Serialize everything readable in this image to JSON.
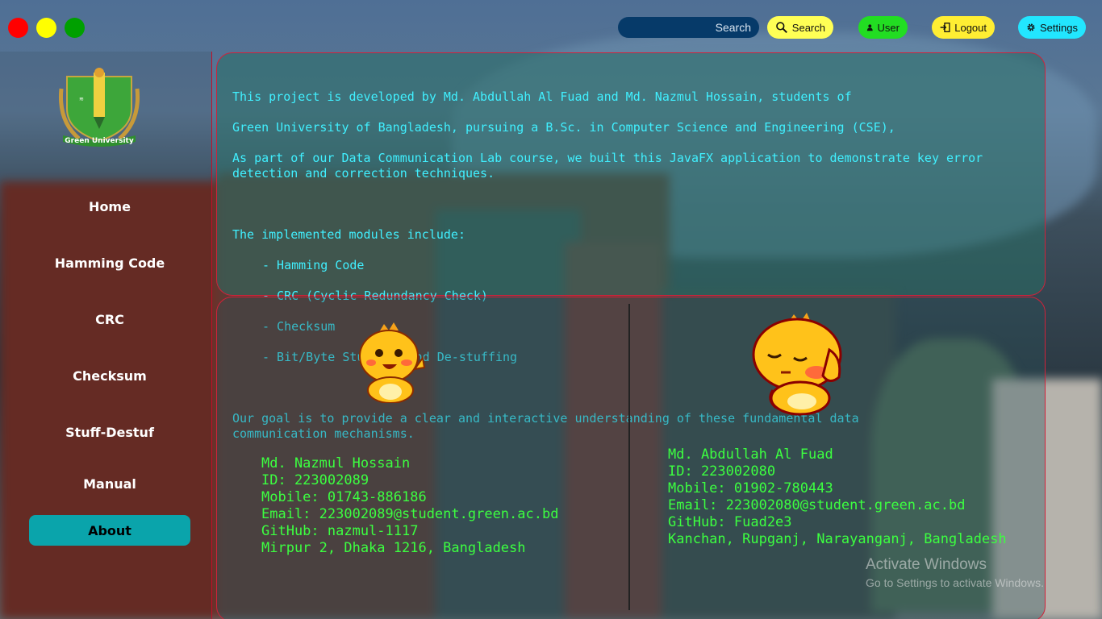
{
  "window": {
    "controls": [
      "close",
      "minimize",
      "maximize"
    ],
    "colors": {
      "close": "#ff0000",
      "minimize": "#ffff00",
      "maximize": "#00a000"
    }
  },
  "toolbar": {
    "search_placeholder": "Search",
    "search_label": "Search",
    "user_label": "User",
    "logout_label": "Logout",
    "settings_label": "Settings"
  },
  "sidebar": {
    "logo_text": "Green University",
    "items": [
      {
        "label": "Home",
        "active": false
      },
      {
        "label": "Hamming Code",
        "active": false
      },
      {
        "label": "CRC",
        "active": false
      },
      {
        "label": "Checksum",
        "active": false
      },
      {
        "label": "Stuff-Destuf",
        "active": false
      },
      {
        "label": "Manual",
        "active": false
      },
      {
        "label": "About",
        "active": true
      }
    ],
    "active_color": "#0aa4ab"
  },
  "about": {
    "line1": "This project is developed by Md. Abdullah Al Fuad and Md. Nazmul Hossain, students of",
    "line2": "Green University of Bangladesh, pursuing a B.Sc. in Computer Science and Engineering (CSE),",
    "line3": "As part of our Data Communication Lab course, we built this JavaFX application to demonstrate key error detection and correction techniques.",
    "modules_intro": "The implemented modules include:",
    "modules": [
      "- Hamming Code",
      "- CRC (Cyclic Redundancy Check)",
      "- Checksum",
      "- Bit/Byte Stuffing and De-stuffing"
    ],
    "goal": "Our goal is to provide a clear and interactive understanding of these fundamental data communication mechanisms."
  },
  "members": [
    {
      "name": "Md. Nazmul Hossain",
      "id": "ID: 223002089",
      "mobile": "Mobile: 01743-886186",
      "email": "Email: 223002089@student.green.ac.bd",
      "github": "GitHub: nazmul-1117",
      "address": "Mirpur 2, Dhaka 1216, Bangladesh"
    },
    {
      "name": "Md. Abdullah Al Fuad",
      "id": "ID: 223002080",
      "mobile": "Mobile: 01902-780443",
      "email": "Email: 223002080@student.green.ac.bd",
      "github": "GitHub: Fuad2e3",
      "address": "Kanchan, Rupganj, Narayanganj, Bangladesh"
    }
  ],
  "watermark": {
    "title": "Activate Windows",
    "subtitle": "Go to Settings to activate Windows."
  },
  "colors": {
    "about_text": "#40f0ff",
    "member_text": "#3cff40",
    "panel_border": "#d0223a"
  }
}
